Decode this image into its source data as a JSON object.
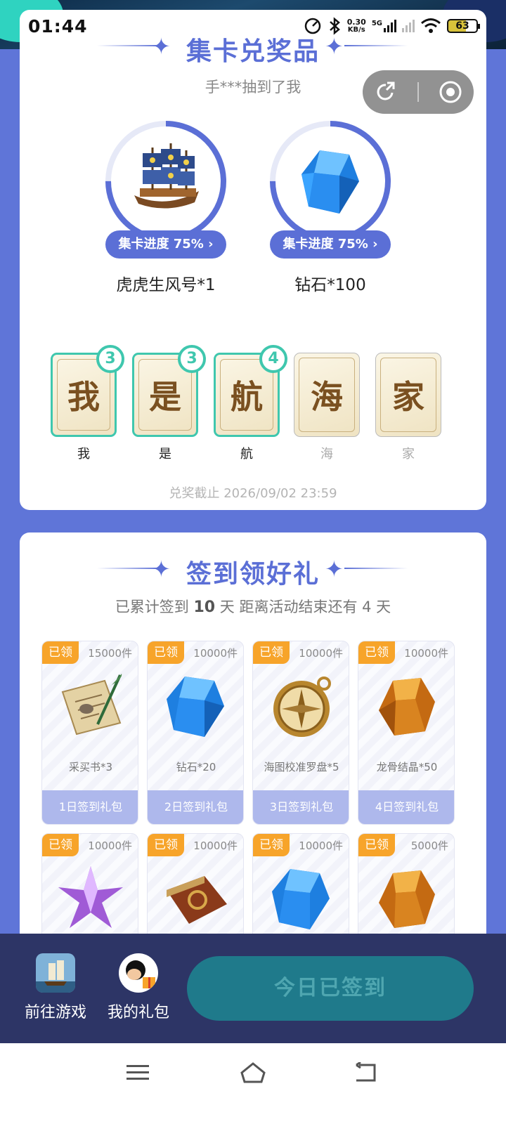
{
  "status_bar": {
    "time": "01:44",
    "speed_value": "0.30",
    "speed_unit": "KB/s",
    "network": "5G",
    "battery": "63"
  },
  "collect_section": {
    "title": "集卡兑奖品",
    "ticker": "手***抽到了我",
    "prizes": [
      {
        "name": "虎虎生风号*1",
        "progress_label": "集卡进度 75%",
        "progress": 0.75,
        "icon": "ship-icon"
      },
      {
        "name": "钻石*100",
        "progress_label": "集卡进度 75%",
        "progress": 0.75,
        "icon": "diamond-icon"
      }
    ],
    "cards": [
      {
        "char": "我",
        "label": "我",
        "count": "3",
        "owned": true
      },
      {
        "char": "是",
        "label": "是",
        "count": "3",
        "owned": true
      },
      {
        "char": "航",
        "label": "航",
        "count": "4",
        "owned": true
      },
      {
        "char": "海",
        "label": "海",
        "count": null,
        "owned": false
      },
      {
        "char": "家",
        "label": "家",
        "count": null,
        "owned": false
      }
    ],
    "deadline": "兑奖截止 2026/09/02 23:59"
  },
  "signin_section": {
    "title": "签到领好礼",
    "stat_prefix": "已累计签到",
    "stat_days": "10",
    "stat_suffix": "天  距离活动结束还有 4 天",
    "gifts": [
      {
        "claimed": "已领",
        "qty": "15000件",
        "name": "采买书*3",
        "label": "1日签到礼包",
        "icon": "scroll-icon"
      },
      {
        "claimed": "已领",
        "qty": "10000件",
        "name": "钻石*20",
        "label": "2日签到礼包",
        "icon": "diamond-icon"
      },
      {
        "claimed": "已领",
        "qty": "10000件",
        "name": "海图校准罗盘*5",
        "label": "3日签到礼包",
        "icon": "compass-icon"
      },
      {
        "claimed": "已领",
        "qty": "10000件",
        "name": "龙骨结晶*50",
        "label": "4日签到礼包",
        "icon": "amber-crystal-icon"
      },
      {
        "claimed": "已领",
        "qty": "10000件",
        "icon": "purple-star-crystal-icon"
      },
      {
        "claimed": "已领",
        "qty": "10000件",
        "icon": "book-icon"
      },
      {
        "claimed": "已领",
        "qty": "10000件",
        "icon": "diamond-icon"
      },
      {
        "claimed": "已领",
        "qty": "5000件",
        "icon": "amber-crystal-icon"
      }
    ]
  },
  "bottom_bar": {
    "go_game": "前往游戏",
    "my_gifts": "我的礼包",
    "checkin_button": "今日已签到"
  },
  "colors": {
    "accent": "#5b6fd6",
    "teal": "#3fc7ae",
    "claimed": "#f7a42a",
    "bottom_bar": "#2d3566"
  }
}
